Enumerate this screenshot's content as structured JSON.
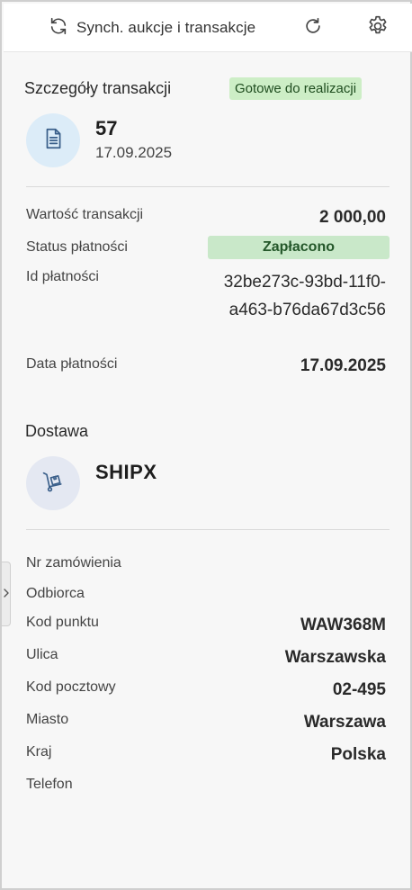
{
  "header": {
    "sync_label": "Synch. aukcje i transakcje",
    "sync_icon": "sync-icon",
    "refresh_icon": "refresh-icon",
    "settings_icon": "gear-icon"
  },
  "transaction": {
    "title": "Szczegóły transakcji",
    "status_badge": "Gotowe do realizacji",
    "icon": "document-icon",
    "number": "57",
    "date": "17.09.2025",
    "rows": {
      "value_label": "Wartość transakcji",
      "value": "2 000,00",
      "payment_status_label": "Status płatności",
      "payment_status": "Zapłacono",
      "payment_id_label": "Id płatności",
      "payment_id": "32be273c-93bd-11f0-a463-b76da67d3c56",
      "payment_date_label": "Data płatności",
      "payment_date": "17.09.2025"
    }
  },
  "delivery": {
    "title": "Dostawa",
    "icon": "hand-truck-icon",
    "carrier": "SHIPX",
    "rows": {
      "order_no_label": "Nr zamówienia",
      "order_no": "",
      "recipient_label": "Odbiorca",
      "recipient": "",
      "point_code_label": "Kod punktu",
      "point_code": "WAW368M",
      "street_label": "Ulica",
      "street": "Warszawska",
      "postal_code_label": "Kod pocztowy",
      "postal_code": "02-495",
      "city_label": "Miasto",
      "city": "Warszawa",
      "country_label": "Kraj",
      "country": "Polska",
      "phone_label": "Telefon",
      "phone": ""
    }
  },
  "colors": {
    "ready_badge_bg": "#cdeec6",
    "paid_badge_bg": "#c9e8c9",
    "doc_avatar_bg": "#dcecf8",
    "cart_avatar_bg": "#e4e8f2",
    "icon_stroke": "#3a5f8a"
  }
}
